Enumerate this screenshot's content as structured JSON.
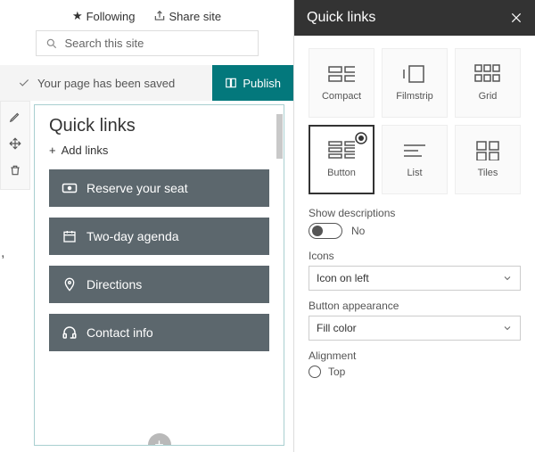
{
  "header": {
    "following": "Following",
    "share": "Share site",
    "search_placeholder": "Search this site"
  },
  "status": {
    "saved": "Your page has been saved",
    "publish": "Publish"
  },
  "webpart": {
    "title": "Quick links",
    "add": "Add links",
    "links": [
      {
        "label": "Reserve your seat",
        "icon": "ticket-icon"
      },
      {
        "label": "Two-day agenda",
        "icon": "calendar-icon"
      },
      {
        "label": "Directions",
        "icon": "map-pin-icon"
      },
      {
        "label": "Contact info",
        "icon": "headset-icon"
      }
    ]
  },
  "panel": {
    "title": "Quick links",
    "layouts": [
      {
        "name": "Compact"
      },
      {
        "name": "Filmstrip"
      },
      {
        "name": "Grid"
      },
      {
        "name": "Button",
        "selected": true
      },
      {
        "name": "List"
      },
      {
        "name": "Tiles"
      }
    ],
    "show_desc_label": "Show descriptions",
    "show_desc_value": "No",
    "icons_label": "Icons",
    "icons_value": "Icon on left",
    "appearance_label": "Button appearance",
    "appearance_value": "Fill color",
    "alignment_label": "Alignment",
    "alignment_option": "Top"
  },
  "stray_char": ","
}
